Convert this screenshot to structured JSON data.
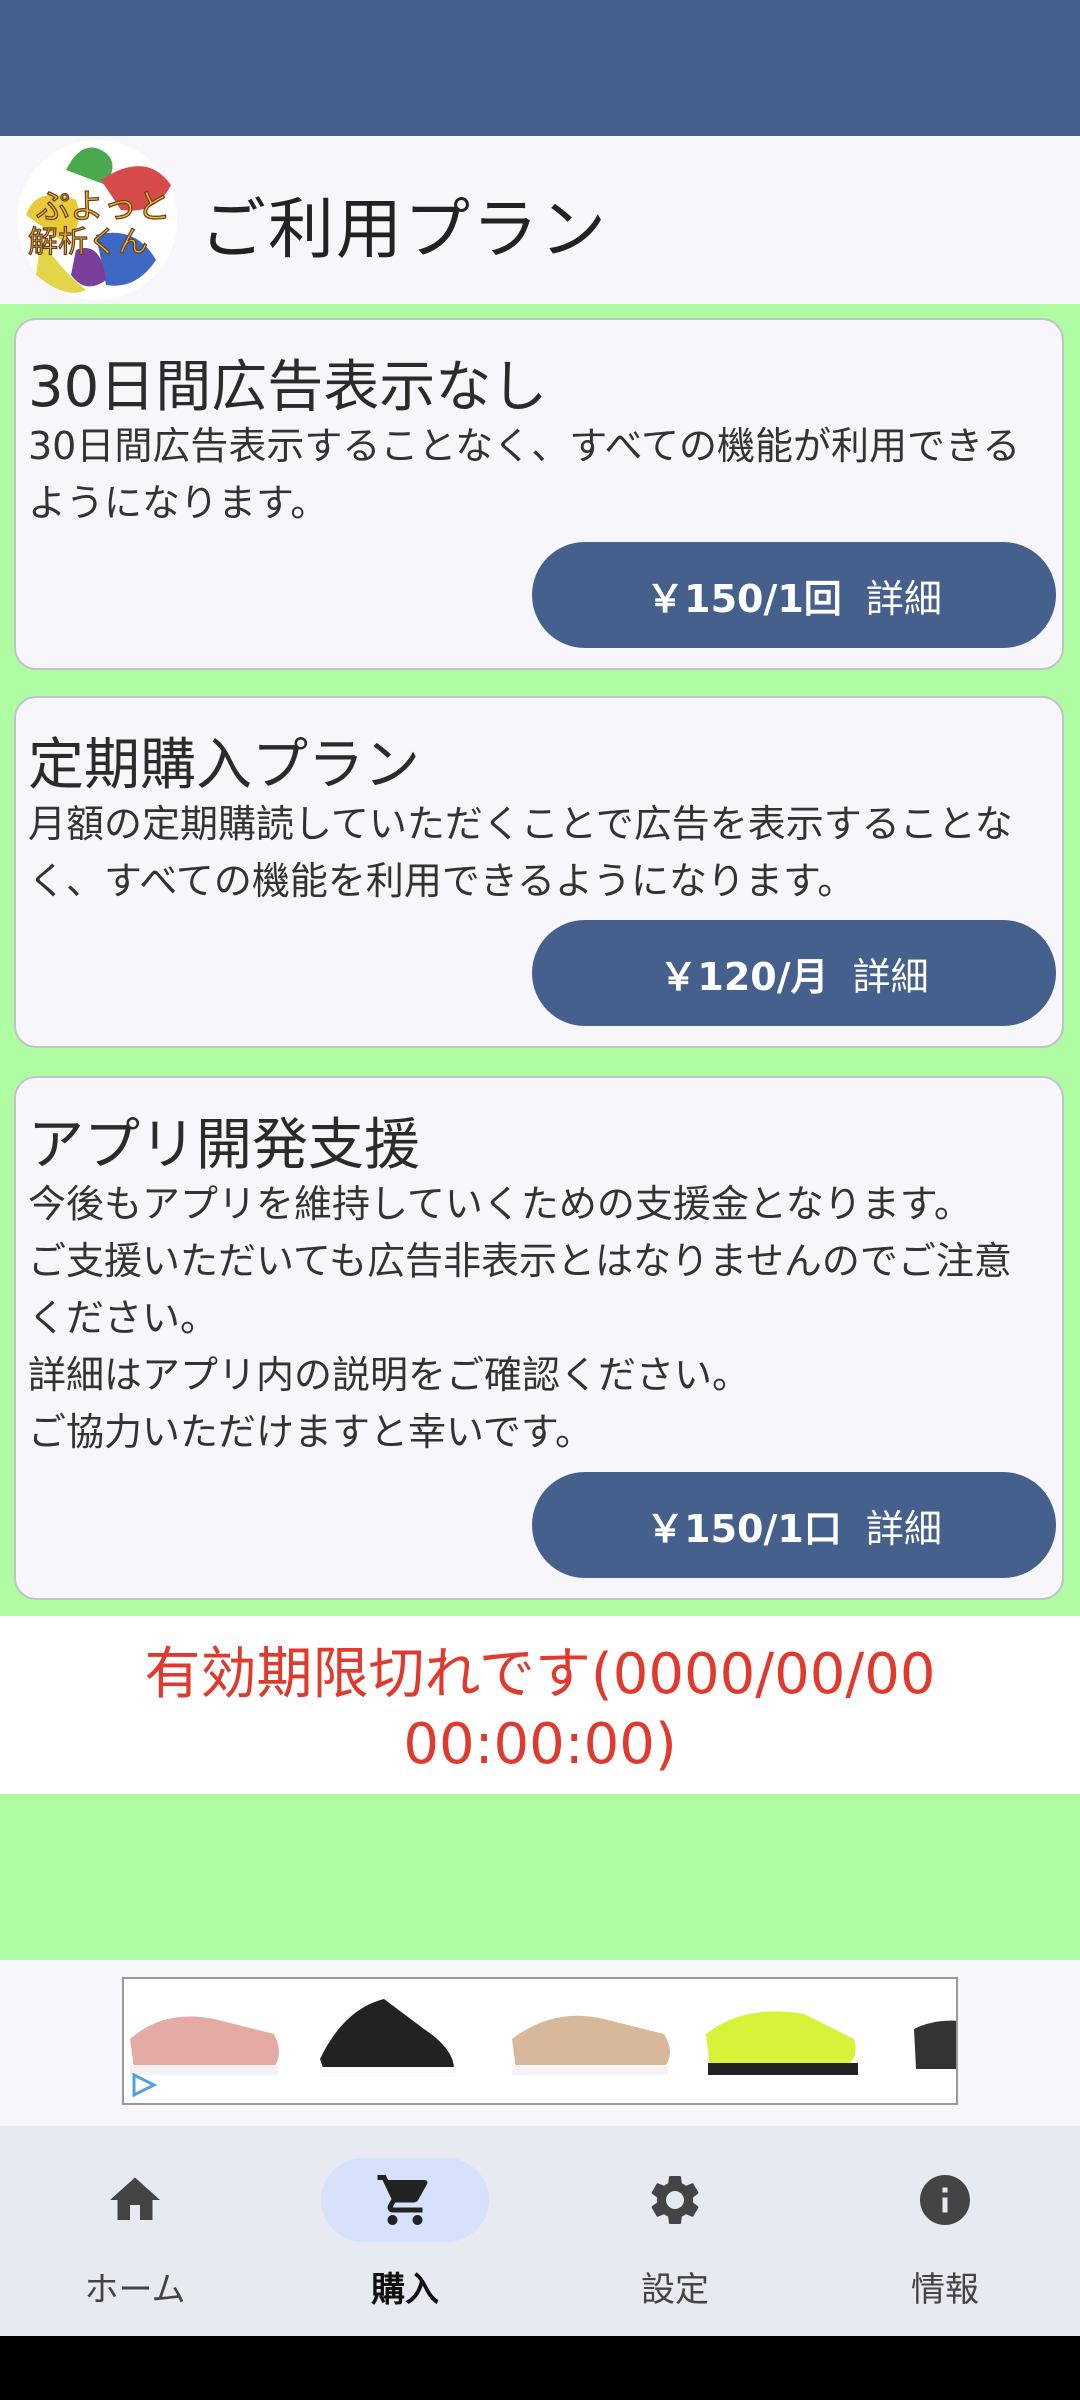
{
  "header": {
    "title": "ご利用プラン",
    "logo_text": [
      "ぷよっと",
      "解析くん"
    ]
  },
  "plans": [
    {
      "title": "30日間広告表示なし",
      "description": "30日間広告表示することなく、すべての機能が利用できるようになります。",
      "price": "￥150/1回",
      "detail": "詳細"
    },
    {
      "title": "定期購入プラン",
      "description": "月額の定期購読していただくことで広告を表示することなく、すべての機能を利用できるようになります。",
      "price": "￥120/月",
      "detail": "詳細"
    },
    {
      "title": "アプリ開発支援",
      "description_lines": [
        "今後もアプリを維持していくための支援金となります。",
        "ご支援いただいても広告非表示とはなりませんのでご注意ください。",
        "詳細はアプリ内の説明をご確認ください。",
        "ご協力いただけますと幸いです。"
      ],
      "price": "￥150/1口",
      "detail": "詳細"
    }
  ],
  "expiry": {
    "line1": "有効期限切れです(0000/00/00",
    "line2": "00:00:00)"
  },
  "nav": [
    {
      "label": "ホーム",
      "icon": "home-icon"
    },
    {
      "label": "購入",
      "icon": "cart-icon",
      "active": true
    },
    {
      "label": "設定",
      "icon": "gear-icon"
    },
    {
      "label": "情報",
      "icon": "info-icon"
    }
  ],
  "colors": {
    "accent": "#46608e",
    "background": "#b0fca3",
    "expiry": "#e03a2e"
  }
}
